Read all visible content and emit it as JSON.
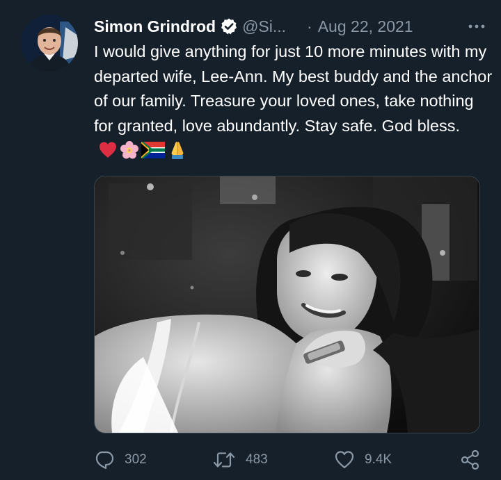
{
  "tweet": {
    "author_name": "Simon Grindrod",
    "handle": "@Si...",
    "separator": "·",
    "date": "Aug 22, 2021",
    "text": "I would give anything for just 10 more minutes with my departed wife, Lee-Ann. My best buddy and the anchor of our family. Treasure your loved ones, take nothing for granted, love abundantly. Stay safe. God bless.",
    "emojis": [
      "red-heart-icon",
      "cherry-blossom-icon",
      "south-africa-flag-icon",
      "folded-hands-icon"
    ],
    "verified": true
  },
  "actions": {
    "replies": "302",
    "retweets": "483",
    "likes": "9.4K"
  },
  "colors": {
    "background": "#15202b",
    "text": "#ffffff",
    "secondary_text": "#8b98a5",
    "border": "#38444d"
  }
}
